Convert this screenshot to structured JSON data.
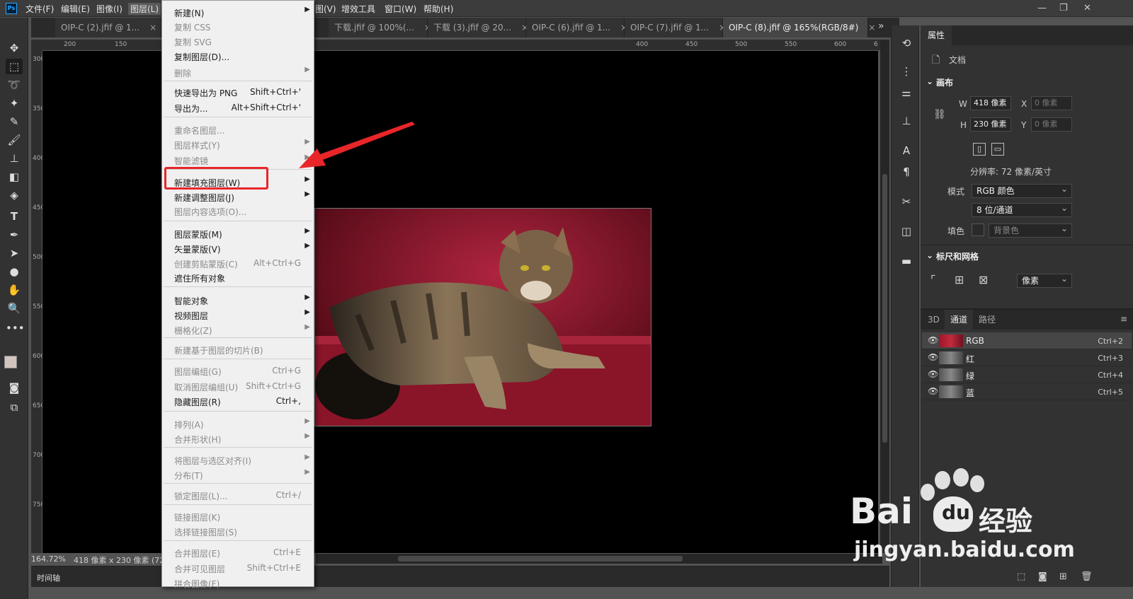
{
  "menubar": {
    "logo": "Ps",
    "items": [
      "文件(F)",
      "编辑(E)",
      "图像(I)",
      "图层(L)",
      "图(V)",
      "增效工具",
      "窗口(W)",
      "帮助(H)"
    ],
    "controls": [
      "—",
      "❐",
      "✕"
    ]
  },
  "tabs": [
    {
      "label": "OIP-C (2).jfif @ 1...",
      "close": "×"
    },
    {
      "label": "下载.jfif @ 100%(...",
      "close": "×"
    },
    {
      "label": "下载 (3).jfif @ 20...",
      "close": "×"
    },
    {
      "label": "OIP-C (6).jfif @ 1...",
      "close": "×"
    },
    {
      "label": "OIP-C (7).jfif @ 1...",
      "close": "×"
    },
    {
      "label": "OIP-C (8).jfif @ 165%(RGB/8#)",
      "close": "×"
    }
  ],
  "tab_overflow": "»",
  "ruler_h": [
    "200",
    "150",
    "400",
    "450",
    "500",
    "550",
    "600",
    "6"
  ],
  "ruler_v": [
    "300",
    "350",
    "400",
    "450",
    "500",
    "550",
    "600",
    "650",
    "700",
    "750"
  ],
  "status": {
    "zoom": "164.72%",
    "info": "418 像素 x 230 像素 (72"
  },
  "timeline": "时间轴",
  "layer_menu": {
    "items": [
      {
        "label": "新建(N)",
        "key": "",
        "sub": true,
        "disabled": false
      },
      {
        "label": "复制 CSS",
        "key": "",
        "sub": false,
        "disabled": true
      },
      {
        "label": "复制 SVG",
        "key": "",
        "sub": false,
        "disabled": true
      },
      {
        "label": "复制图层(D)...",
        "key": "",
        "sub": false,
        "disabled": false
      },
      {
        "label": "删除",
        "key": "",
        "sub": true,
        "disabled": true
      },
      {
        "label": "快速导出为 PNG",
        "key": "Shift+Ctrl+'",
        "sub": false,
        "disabled": false
      },
      {
        "label": "导出为...",
        "key": "Alt+Shift+Ctrl+'",
        "sub": false,
        "disabled": false
      },
      {
        "label": "重命名图层...",
        "key": "",
        "sub": false,
        "disabled": true
      },
      {
        "label": "图层样式(Y)",
        "key": "",
        "sub": true,
        "disabled": true
      },
      {
        "label": "智能滤镜",
        "key": "",
        "sub": true,
        "disabled": true
      },
      {
        "label": "新建填充图层(W)",
        "key": "",
        "sub": true,
        "disabled": false
      },
      {
        "label": "新建调整图层(J)",
        "key": "",
        "sub": true,
        "disabled": false
      },
      {
        "label": "图层内容选项(O)...",
        "key": "",
        "sub": false,
        "disabled": true
      },
      {
        "label": "图层蒙版(M)",
        "key": "",
        "sub": true,
        "disabled": false
      },
      {
        "label": "矢量蒙版(V)",
        "key": "",
        "sub": true,
        "disabled": false
      },
      {
        "label": "创建剪贴蒙版(C)",
        "key": "Alt+Ctrl+G",
        "sub": false,
        "disabled": true
      },
      {
        "label": "遮住所有对象",
        "key": "",
        "sub": false,
        "disabled": false
      },
      {
        "label": "智能对象",
        "key": "",
        "sub": true,
        "disabled": false
      },
      {
        "label": "视频图层",
        "key": "",
        "sub": true,
        "disabled": false
      },
      {
        "label": "栅格化(Z)",
        "key": "",
        "sub": true,
        "disabled": true
      },
      {
        "label": "新建基于图层的切片(B)",
        "key": "",
        "sub": false,
        "disabled": true
      },
      {
        "label": "图层编组(G)",
        "key": "Ctrl+G",
        "sub": false,
        "disabled": true
      },
      {
        "label": "取消图层编组(U)",
        "key": "Shift+Ctrl+G",
        "sub": false,
        "disabled": true
      },
      {
        "label": "隐藏图层(R)",
        "key": "Ctrl+,",
        "sub": false,
        "disabled": false
      },
      {
        "label": "排列(A)",
        "key": "",
        "sub": true,
        "disabled": true
      },
      {
        "label": "合并形状(H)",
        "key": "",
        "sub": true,
        "disabled": true
      },
      {
        "label": "将图层与选区对齐(I)",
        "key": "",
        "sub": true,
        "disabled": true
      },
      {
        "label": "分布(T)",
        "key": "",
        "sub": true,
        "disabled": true
      },
      {
        "label": "锁定图层(L)...",
        "key": "Ctrl+/",
        "sub": false,
        "disabled": true
      },
      {
        "label": "链接图层(K)",
        "key": "",
        "sub": false,
        "disabled": true
      },
      {
        "label": "选择链接图层(S)",
        "key": "",
        "sub": false,
        "disabled": true
      },
      {
        "label": "合并图层(E)",
        "key": "Ctrl+E",
        "sub": false,
        "disabled": true
      },
      {
        "label": "合并可见图层",
        "key": "Shift+Ctrl+E",
        "sub": false,
        "disabled": true
      },
      {
        "label": "拼合图像(F)",
        "key": "",
        "sub": false,
        "disabled": true
      }
    ]
  },
  "properties": {
    "tab": "属性",
    "doc_label": "文档",
    "canvas_section": "画布",
    "w_label": "W",
    "w_value": "418 像素",
    "x_label": "X",
    "x_placeholder": "0 像素",
    "h_label": "H",
    "h_value": "230 像素",
    "y_label": "Y",
    "y_placeholder": "0 像素",
    "resolution": "分辨率: 72 像素/英寸",
    "mode_label": "模式",
    "mode_value": "RGB 颜色",
    "depth_value": "8 位/通道",
    "fill_label": "填色",
    "fill_value": "背景色",
    "rulers_section": "标尺和网格",
    "units_value": "像素"
  },
  "channels": {
    "tabs": [
      "3D",
      "通道",
      "路径"
    ],
    "rows": [
      {
        "name": "RGB",
        "key": "Ctrl+2"
      },
      {
        "name": "红",
        "key": "Ctrl+3"
      },
      {
        "name": "绿",
        "key": "Ctrl+4"
      },
      {
        "name": "蓝",
        "key": "Ctrl+5"
      }
    ]
  },
  "watermark": {
    "brand": "Bai",
    "brand_tail": "经验",
    "url": "jingyan.baidu.com"
  },
  "colors": {
    "annotation": "#e8262a",
    "menu_bg": "#f0f0f0",
    "app_bg": "#323232"
  }
}
